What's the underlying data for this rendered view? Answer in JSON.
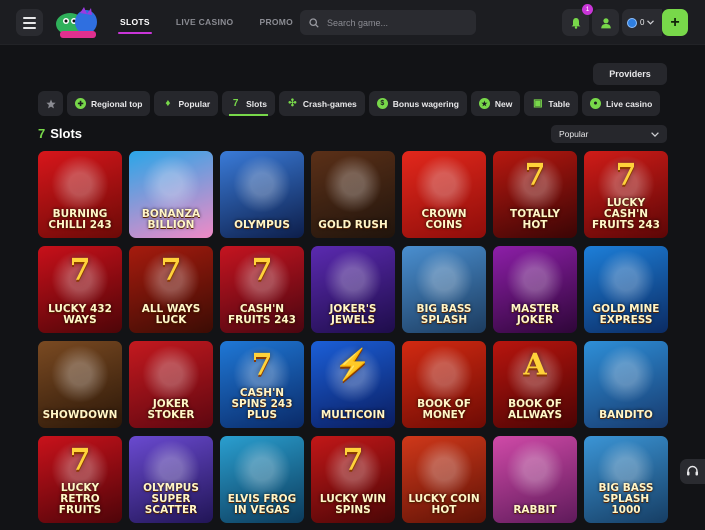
{
  "header": {
    "nav": [
      {
        "label": "SLOTS",
        "active": true
      },
      {
        "label": "LIVE CASINO",
        "active": false
      },
      {
        "label": "PROMO",
        "active": false
      }
    ],
    "search_placeholder": "Search game...",
    "notification_count": "1",
    "balance": "0",
    "deposit_label": "+",
    "accent": "#c936d8",
    "green": "#78d84a"
  },
  "providers_label": "Providers",
  "categories": [
    {
      "label": "Regional top",
      "icon": "globe-icon"
    },
    {
      "label": "Popular",
      "icon": "flame-icon"
    },
    {
      "label": "Slots",
      "icon": "seven-icon",
      "active": true
    },
    {
      "label": "Crash-games",
      "icon": "crash-icon"
    },
    {
      "label": "Bonus wagering",
      "icon": "coin-icon"
    },
    {
      "label": "New",
      "icon": "new-icon"
    },
    {
      "label": "Table",
      "icon": "cards-icon"
    },
    {
      "label": "Live casino",
      "icon": "live-icon"
    }
  ],
  "section": {
    "icon": "7",
    "title": "Slots"
  },
  "sort": {
    "selected": "Popular"
  },
  "games": [
    {
      "title": "Burning Chilli 243",
      "art": "",
      "colors": [
        "#d8161b",
        "#6b0a07"
      ]
    },
    {
      "title": "Bonanza Billion",
      "art": "",
      "colors": [
        "#2aa6e8",
        "#f08ac6"
      ]
    },
    {
      "title": "Olympus",
      "art": "",
      "colors": [
        "#3a7bd8",
        "#0d1e4a"
      ]
    },
    {
      "title": "Gold Rush",
      "art": "",
      "colors": [
        "#5b3018",
        "#20140c"
      ]
    },
    {
      "title": "Crown Coins",
      "art": "",
      "colors": [
        "#e3281c",
        "#8e0d0a"
      ]
    },
    {
      "title": "Totally Hot",
      "art": "7",
      "colors": [
        "#b81810",
        "#3a0505"
      ]
    },
    {
      "title": "Lucky Cash'n Fruits 243",
      "art": "7",
      "colors": [
        "#d01c18",
        "#5c0606"
      ]
    },
    {
      "title": "Lucky 432 Ways",
      "art": "7",
      "colors": [
        "#c8101a",
        "#4d0508"
      ]
    },
    {
      "title": "All Ways Luck",
      "art": "7",
      "colors": [
        "#a61b0e",
        "#3b0c04"
      ]
    },
    {
      "title": "Cash'n Fruits 243",
      "art": "7",
      "colors": [
        "#c51420",
        "#4a0610"
      ]
    },
    {
      "title": "Joker's Jewels",
      "art": "",
      "colors": [
        "#5b2ab0",
        "#1e0d4a"
      ]
    },
    {
      "title": "Big Bass Splash",
      "art": "",
      "colors": [
        "#4a8fd0",
        "#1c3b5e"
      ]
    },
    {
      "title": "Master Joker",
      "art": "",
      "colors": [
        "#8d1fa8",
        "#2e0638"
      ]
    },
    {
      "title": "Gold Mine Express",
      "art": "",
      "colors": [
        "#1d7fd9",
        "#0b2b63"
      ]
    },
    {
      "title": "Showdown",
      "art": "",
      "colors": [
        "#7a4a22",
        "#2b1708"
      ]
    },
    {
      "title": "Joker Stoker",
      "art": "",
      "colors": [
        "#c4191f",
        "#5e0710"
      ]
    },
    {
      "title": "Cash'n Spins 243 Plus",
      "art": "7",
      "colors": [
        "#1f78d6",
        "#0a2a68"
      ]
    },
    {
      "title": "Multicoin",
      "art": "⚡",
      "colors": [
        "#1b5fd8",
        "#0a1c5e"
      ]
    },
    {
      "title": "Book of Money",
      "art": "",
      "colors": [
        "#d22a12",
        "#6e0b04"
      ]
    },
    {
      "title": "Book of Allways",
      "art": "A",
      "colors": [
        "#b8150e",
        "#4b0404"
      ]
    },
    {
      "title": "Bandito",
      "art": "",
      "colors": [
        "#2e8fd8",
        "#173a6e"
      ]
    },
    {
      "title": "Lucky Retro Fruits",
      "art": "7",
      "colors": [
        "#c9121b",
        "#4e0409"
      ]
    },
    {
      "title": "Olympus Super Scatter",
      "art": "",
      "colors": [
        "#6a4ad0",
        "#211556"
      ]
    },
    {
      "title": "Elvis Frog in Vegas",
      "art": "",
      "colors": [
        "#2a9fd0",
        "#0c3a5a"
      ]
    },
    {
      "title": "Lucky Win Spins",
      "art": "7",
      "colors": [
        "#c21718",
        "#4a0606"
      ]
    },
    {
      "title": "Lucky Coin Hot",
      "art": "",
      "colors": [
        "#d0381a",
        "#5e1206"
      ]
    },
    {
      "title": "Rabbit",
      "art": "",
      "colors": [
        "#d04aa8",
        "#5e1a5a"
      ]
    },
    {
      "title": "Big Bass Splash 1000",
      "art": "",
      "colors": [
        "#3b95d6",
        "#163d63"
      ]
    }
  ]
}
